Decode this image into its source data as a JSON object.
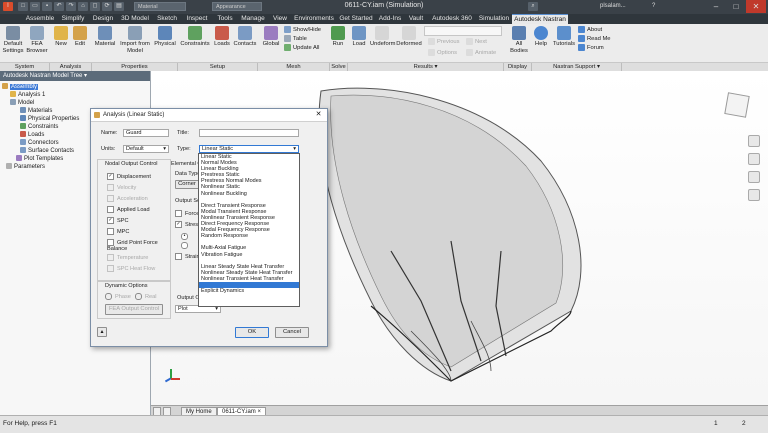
{
  "window": {
    "title": "0611-CY.iam (Simulation)",
    "material_dropdown": "Material",
    "appearance_dropdown": "Appearance",
    "user": "plsalam..."
  },
  "ribbon_tabs": [
    "Assemble",
    "Simplify",
    "Design",
    "3D Model",
    "Sketch",
    "Inspect",
    "Tools",
    "Manage",
    "View",
    "Environments",
    "Get Started",
    "Add-Ins",
    "Vault",
    "Autodesk 360",
    "Simulation",
    "Autodesk Nastran"
  ],
  "ribbon": {
    "default_settings": "Default Settings",
    "fea_browser": "FEA Browser",
    "new": "New",
    "edit": "Edit",
    "material": "Material",
    "import_from_model": "Import from Model",
    "physical": "Physical",
    "constraints": "Constraints",
    "loads": "Loads",
    "contacts": "Contacts",
    "global": "Global",
    "show_hide": "Show/Hide",
    "table": "Table",
    "update_all": "Update All",
    "run": "Run",
    "load": "Load",
    "undeform": "Undeform",
    "deformed": "Deformed",
    "previous": "Previous",
    "next": "Next",
    "options": "Options",
    "animate": "Animate",
    "all_bodies": "All Bodies",
    "help": "Help",
    "tutorials": "Tutorials",
    "about": "About",
    "read_me": "Read Me",
    "forum": "Forum"
  },
  "panels": [
    "System",
    "Analysis",
    "Properties",
    "Setup",
    "Mesh",
    "Solve",
    "Results ▾",
    "Display",
    "Nastran Support ▾"
  ],
  "tree": {
    "header": "Autodesk Nastran Model Tree ▾",
    "nodes": [
      "Assembly",
      "Analysis 1",
      "Model",
      "Materials",
      "Physical Properties",
      "Constraints",
      "Loads",
      "Connectors",
      "Surface Contacts",
      "Plot Templates",
      "Parameters"
    ]
  },
  "dialog": {
    "title": "Analysis (Linear Static)",
    "name_label": "Name:",
    "name_value": "Guard",
    "title_label": "Title:",
    "units_label": "Units:",
    "units_value": "Default",
    "type_label": "Type:",
    "type_value": "Linear Static",
    "nodal_output_header": "Nodal Output Control",
    "nodal_items": [
      {
        "label": "Displacement",
        "checked": true,
        "enabled": true
      },
      {
        "label": "Velocity",
        "checked": false,
        "enabled": false
      },
      {
        "label": "Acceleration",
        "checked": false,
        "enabled": false
      },
      {
        "label": "Applied Load",
        "checked": false,
        "enabled": true
      },
      {
        "label": "SPC",
        "checked": true,
        "enabled": true
      },
      {
        "label": "MPC",
        "checked": false,
        "enabled": true
      },
      {
        "label": "Grid Point Force Balance",
        "checked": false,
        "enabled": true
      },
      {
        "label": "Temperature",
        "checked": false,
        "enabled": false
      },
      {
        "label": "SPC Heat Flow",
        "checked": false,
        "enabled": false
      }
    ],
    "dynamic_options": "Dynamic Options",
    "phase": "Phase",
    "real": "Real",
    "fea_output_control": "FEA Output Control",
    "elemental_output": "Elemental Ou",
    "data_type": "Data Type",
    "corner": "Corner",
    "output_set": "Output Set",
    "force": "Force",
    "stress": "Stress",
    "strain_e": "Strain E",
    "output_options": "Output Op",
    "plot_value": "Plot",
    "ok": "OK",
    "cancel": "Cancel"
  },
  "type_options": [
    "Linear Static",
    "Normal Modes",
    "Linear Buckling",
    "Prestress Static",
    "Prestress Normal Modes",
    "Nonlinear Static",
    "Nonlinear Buckling",
    "",
    "Direct Transient Response",
    "Modal Transient Response",
    "Nonlinear Transient Response",
    "Direct Frequency Response",
    "Modal Frequency Response",
    "Random Response",
    "",
    "Multi-Axial Fatigue",
    "Vibration Fatigue",
    "",
    "Linear Steady State Heat Transfer",
    "Nonlinear Steady State Heat Transfer",
    "Nonlinear Transient Heat Transfer",
    "",
    "Explicit Dynamics"
  ],
  "type_highlight_index": 21,
  "doc_tabs": [
    "My Home",
    "0611-CY.iam"
  ],
  "status": {
    "left": "For Help, press F1",
    "page_a": "1",
    "page_b": "2"
  }
}
